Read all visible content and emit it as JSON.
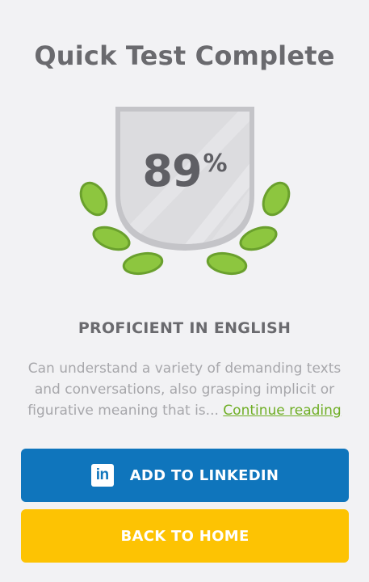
{
  "title": "Quick Test Complete",
  "score": {
    "value": "89",
    "unit": "%"
  },
  "proficiency": {
    "level": "PROFICIENT IN ENGLISH",
    "description": "Can understand a variety of demanding texts and conversations, also grasping implicit or figurative meaning that is...",
    "continue_label": "Continue reading"
  },
  "buttons": {
    "linkedin_label": "ADD TO LINKEDIN",
    "linkedin_icon": "in",
    "home_label": "BACK TO HOME"
  },
  "colors": {
    "linkedin_blue": "#0f75bc",
    "home_yellow": "#fdc303",
    "link_green": "#6fae25",
    "leaf_green": "#8dc63f"
  },
  "icons": {
    "badge": "shield-badge-icon",
    "laurel": "laurel-leaves-icon",
    "linkedin": "linkedin-icon"
  }
}
